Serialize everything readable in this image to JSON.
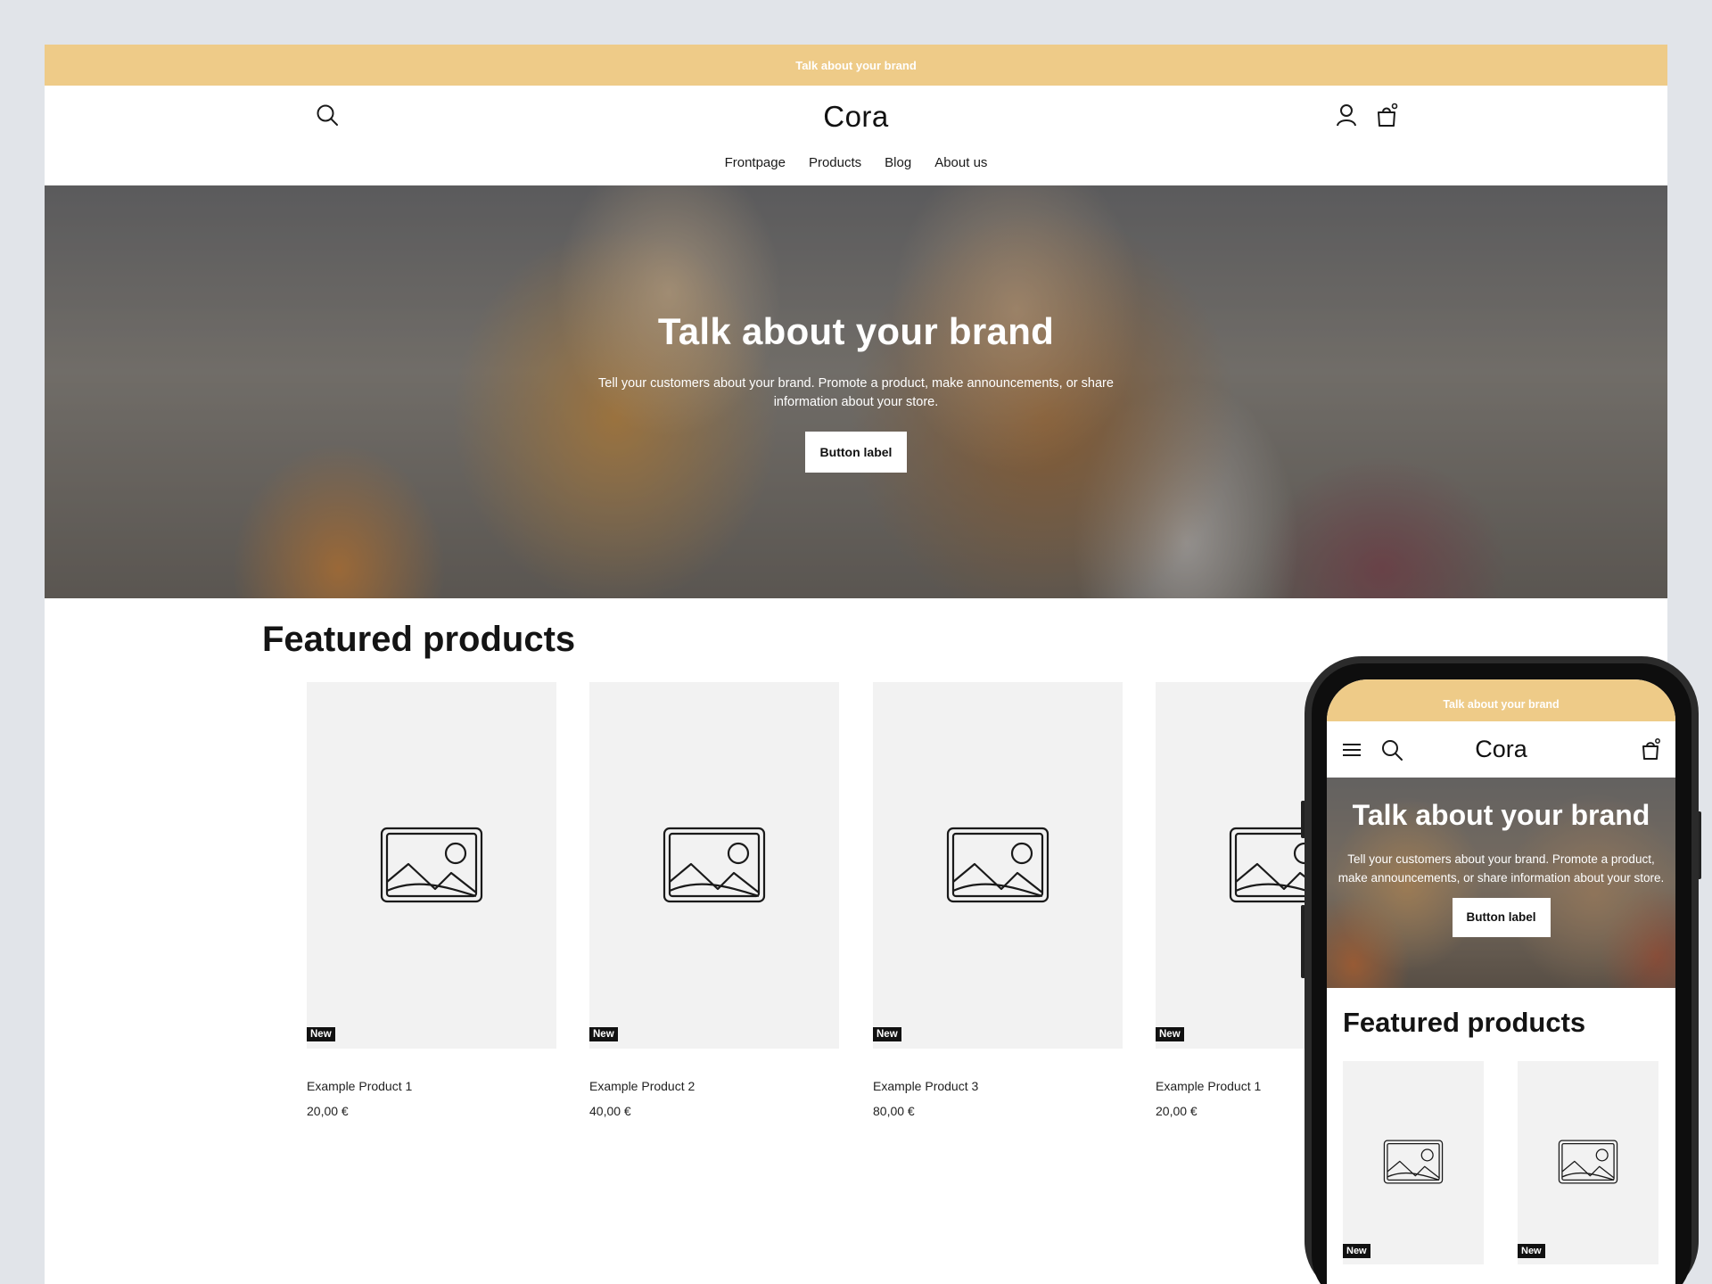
{
  "announcement": "Talk about your brand",
  "store": {
    "logo": "Cora"
  },
  "nav": [
    "Frontpage",
    "Products",
    "Blog",
    "About us"
  ],
  "hero": {
    "title": "Talk about your brand",
    "text": "Tell your customers about your brand. Promote a product, make announcements, or share information about your store.",
    "button": "Button label"
  },
  "featured": {
    "title": "Featured products",
    "products": [
      {
        "badge": "New",
        "name": "Example Product 1",
        "price": "20,00 €"
      },
      {
        "badge": "New",
        "name": "Example Product 2",
        "price": "40,00 €"
      },
      {
        "badge": "New",
        "name": "Example Product 3",
        "price": "80,00 €"
      },
      {
        "badge": "New",
        "name": "Example Product 1",
        "price": "20,00 €"
      }
    ]
  },
  "mobile": {
    "announcement": "Talk about your brand",
    "logo": "Cora",
    "hero_title": "Talk about your brand",
    "hero_text": "Tell your customers about your brand. Promote a product, make announcements, or share information about your store.",
    "hero_button": "Button label",
    "featured_title": "Featured products",
    "badges": [
      "New",
      "New"
    ]
  },
  "icons": [
    "search-icon",
    "account-icon",
    "cart-icon",
    "menu-icon",
    "image-placeholder-icon"
  ],
  "colors": {
    "announcement_bar": "#eecb88",
    "background": "#e1e4e9",
    "placeholder": "#f2f2f2",
    "badge": "#111111"
  }
}
